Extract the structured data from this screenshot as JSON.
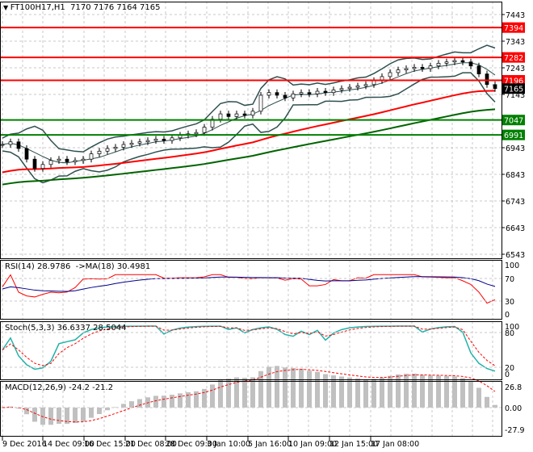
{
  "header": {
    "symbol_icon": "triangle-down-icon",
    "title": "FT100H17,H1",
    "ohlc": "7170 7176 7164 7165"
  },
  "colors": {
    "resistance": "#ff0000",
    "support": "#008000",
    "ma_fast": "#ff0000",
    "ma_slow": "#006400",
    "bands": "#2f4f4f",
    "rsi": "#ff0000",
    "rsi_ma": "#00008b",
    "stoch_main": "#20b2aa",
    "stoch_signal": "#ff0000",
    "macd_hist": "#c0c0c0",
    "macd_signal": "#ff0000"
  },
  "price_axis": {
    "ticks": [
      "7443",
      "7343",
      "7243",
      "7143",
      "6943",
      "6843",
      "6743",
      "6643",
      "6543"
    ]
  },
  "levels": [
    {
      "value": "7394",
      "type": "resistance"
    },
    {
      "value": "7282",
      "type": "resistance"
    },
    {
      "value": "7196",
      "type": "resistance"
    },
    {
      "value": "7047",
      "type": "support"
    },
    {
      "value": "6991",
      "type": "support"
    }
  ],
  "current_price": "7165",
  "rsi": {
    "label": "RSI(14) 28.9786  ->MA(18) 30.4981",
    "ticks": [
      "100",
      "70",
      "30",
      "0"
    ]
  },
  "stoch": {
    "label": "Stoch(5,3,3) 36.6337 28.5044",
    "ticks": [
      "100",
      "80",
      "20",
      "0"
    ]
  },
  "macd": {
    "label": "MACD(12,26,9) -24.2 -21.2",
    "ticks": [
      "26.8",
      "0.00",
      "-27.9"
    ]
  },
  "time_axis": [
    "9 Dec 2016",
    "14 Dec 09:00",
    "16 Dec 15:00",
    "21 Dec 08:00",
    "28 Dec 09:00",
    "3 Jan 10:00",
    "5 Jan 16:00",
    "10 Jan 09:00",
    "12 Jan 15:00",
    "17 Jan 08:00"
  ],
  "chart_data": {
    "type": "line",
    "title": "FT100H17,H1",
    "ylim": [
      6543,
      7443
    ],
    "closes": [
      6955,
      6965,
      6940,
      6900,
      6865,
      6880,
      6895,
      6900,
      6890,
      6895,
      6900,
      6920,
      6930,
      6940,
      6945,
      6955,
      6960,
      6965,
      6970,
      6975,
      6970,
      6980,
      6990,
      6995,
      7000,
      7020,
      7050,
      7070,
      7060,
      7070,
      7065,
      7080,
      7140,
      7150,
      7140,
      7130,
      7145,
      7150,
      7145,
      7155,
      7150,
      7160,
      7165,
      7170,
      7175,
      7180,
      7195,
      7210,
      7225,
      7235,
      7240,
      7245,
      7240,
      7250,
      7260,
      7265,
      7270,
      7265,
      7250,
      7220,
      7180,
      7165
    ]
  }
}
